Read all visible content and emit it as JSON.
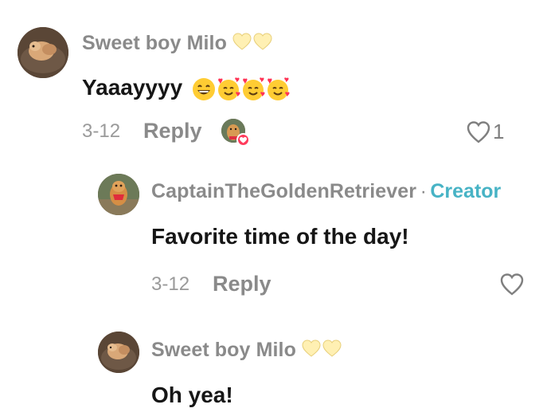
{
  "comments": [
    {
      "username": "Sweet boy Milo",
      "text": "Yaaayyyy",
      "emojis": [
        "grinning-face",
        "smiling-face-with-hearts",
        "smiling-face-with-hearts",
        "smiling-face-with-hearts"
      ],
      "date": "3-12",
      "reply_label": "Reply",
      "like_count": "1"
    }
  ],
  "replies": [
    {
      "username": "CaptainTheGoldenRetriever",
      "separator": "·",
      "badge": "Creator",
      "text": "Favorite time of the day!",
      "date": "3-12",
      "reply_label": "Reply"
    },
    {
      "username": "Sweet boy Milo",
      "text": "Oh yea!"
    }
  ],
  "colors": {
    "username": "#8a8a8a",
    "text": "#161616",
    "creator_badge": "#47b3c5",
    "liked_heart_badge": "#ff3b5c",
    "yellow_heart": "#fff0b3"
  }
}
